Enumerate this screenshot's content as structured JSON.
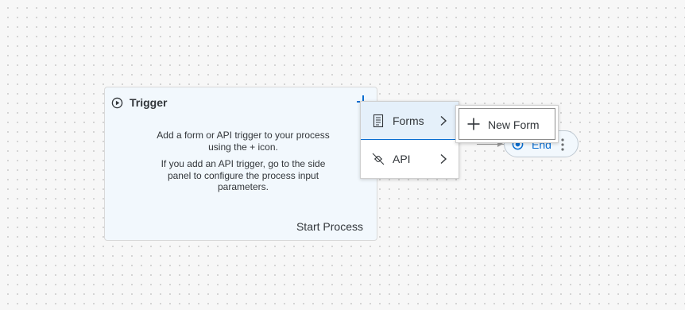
{
  "trigger_card": {
    "title": "Trigger",
    "description_1": "Add a form or API trigger to your process using the + icon.",
    "description_2": "If you add an API trigger, go to the side panel to configure the process input parameters.",
    "footer_label": "Start Process",
    "icons": [
      "play-circle-icon",
      "plus-icon"
    ]
  },
  "end_node": {
    "label": "End",
    "icons": [
      "stop-circle-icon",
      "more-vertical-icon"
    ]
  },
  "menu": {
    "items": [
      {
        "label": "Forms",
        "icon": "form-icon",
        "active": true
      },
      {
        "label": "API",
        "icon": "api-icon",
        "active": false
      }
    ]
  },
  "submenu": {
    "new_form_label": "New Form",
    "icon": "plus-icon"
  },
  "colors": {
    "accent": "#0a6ed1",
    "card_bg": "#f2f8fd",
    "active_item_bg": "#e5f0fa",
    "text": "#32363a"
  }
}
